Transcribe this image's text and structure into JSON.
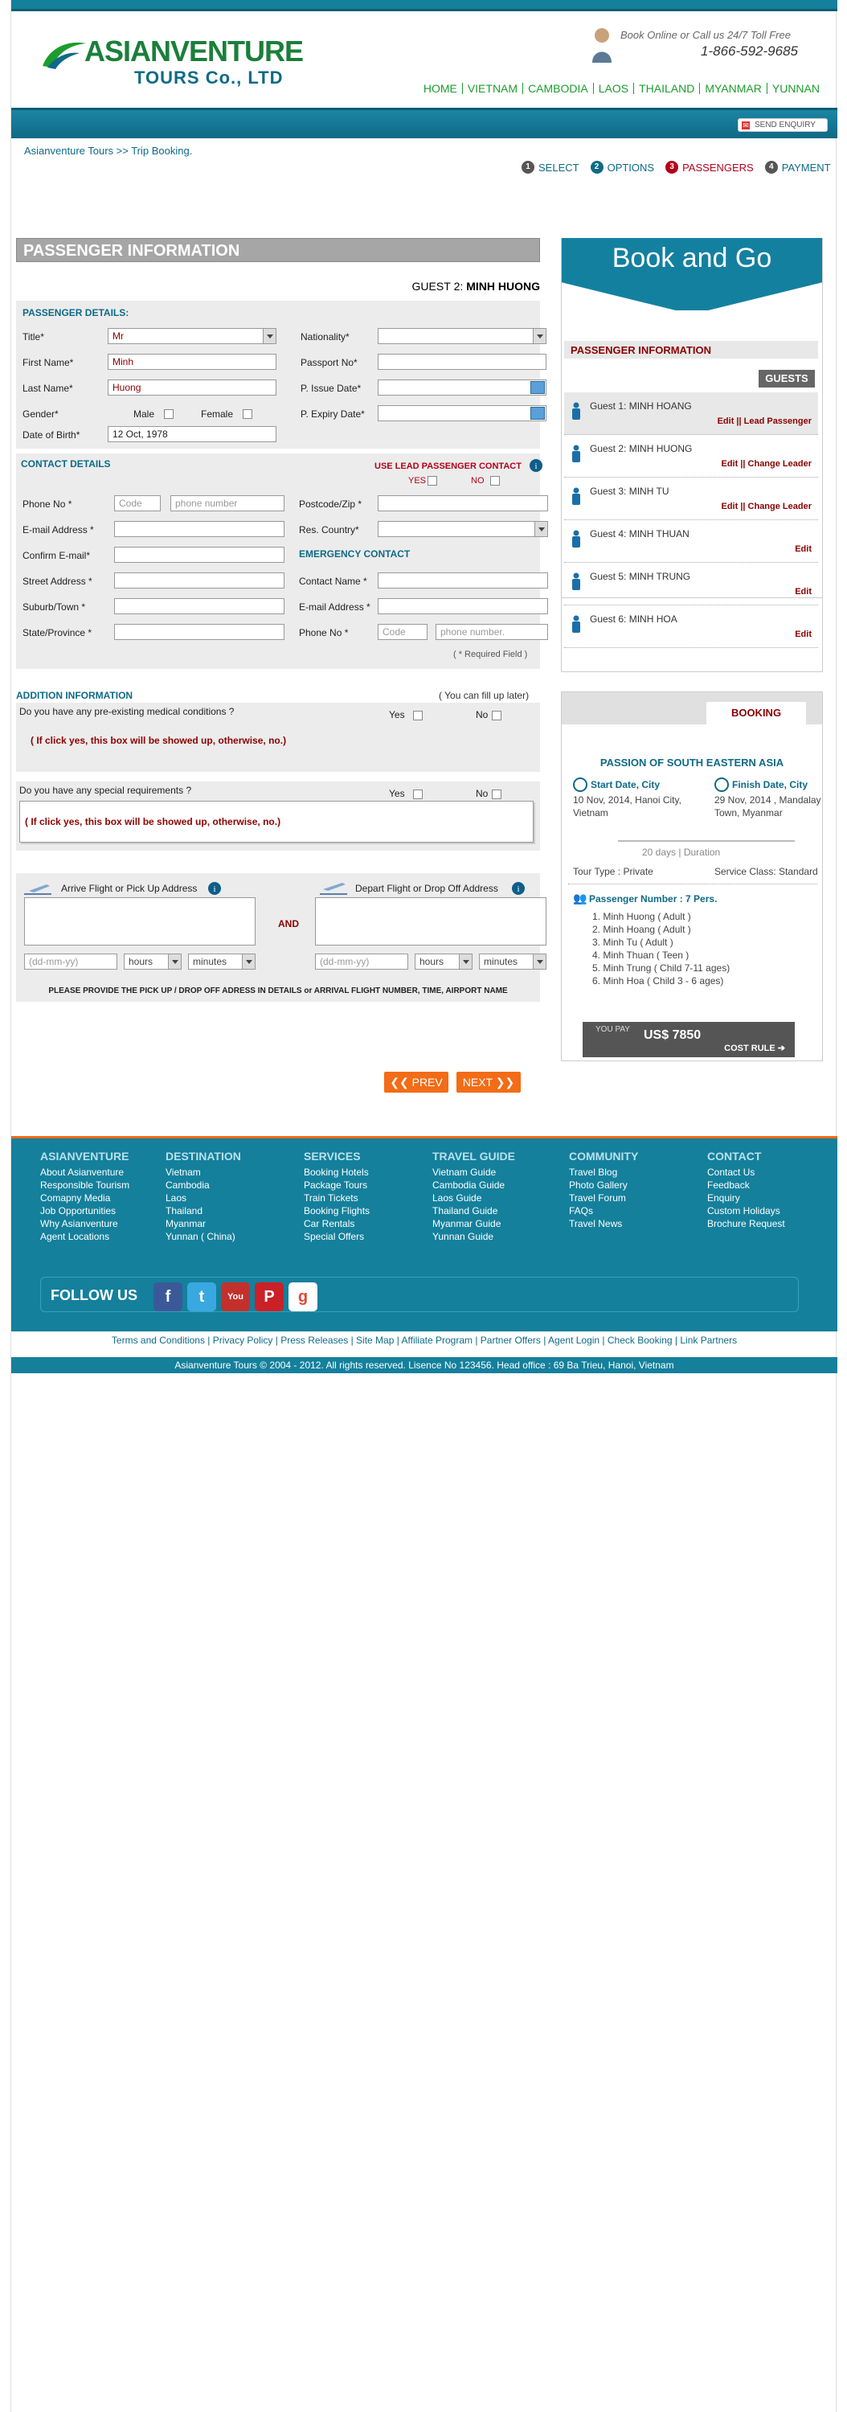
{
  "header": {
    "brand_main": "ASIANVENTURE",
    "brand_sub": "TOURS Co., LTD",
    "call_text": "Book Online or Call us 24/7 Toll Free",
    "phone": "1-866-592-9685",
    "nav": [
      "HOME",
      "VIETNAM",
      "CAMBODIA",
      "LAOS",
      "THAILAND",
      "MYANMAR",
      "YUNNAN"
    ],
    "send_enquiry": "SEND ENQUIRY"
  },
  "breadcrumb": "Asianventure Tours >> Trip Booking.",
  "steps": [
    {
      "num": "1",
      "label": "SELECT"
    },
    {
      "num": "2",
      "label": "OPTIONS"
    },
    {
      "num": "3",
      "label": "PASSENGERS"
    },
    {
      "num": "4",
      "label": "PAYMENT"
    }
  ],
  "form": {
    "title": "PASSENGER INFORMATION",
    "guest_label": "GUEST",
    "guest_num": "2:",
    "guest_name": "MINH HUONG",
    "passenger_details": "PASSENGER DETAILS:",
    "title_label": "Title*",
    "title_value": "Mr",
    "first_name_label": "First Name*",
    "first_name": "Minh",
    "last_name_label": "Last Name*",
    "last_name": "Huong",
    "gender_label": "Gender*",
    "male": "Male",
    "female": "Female",
    "dob_label": "Date of Birth*",
    "dob": "12 Oct, 1978",
    "nationality_label": "Nationality*",
    "passport_label": "Passport No*",
    "issue_label": "P. Issue Date*",
    "expiry_label": "P. Expiry Date*",
    "contact_details": "CONTACT DETAILS",
    "use_lead": "USE LEAD PASSENGER CONTACT",
    "yes": "YES",
    "no": "NO",
    "phone_label": "Phone No *",
    "code_ph": "Code",
    "phone_ph": "phone number",
    "email_label": "E-mail Address *",
    "confirm_email_label": "Confirm E-mail*",
    "street_label": "Street Address *",
    "suburb_label": "Suburb/Town *",
    "state_label": "State/Province  *",
    "postcode_label": "Postcode/Zip  *",
    "res_country_label": "Res. Country*",
    "emergency": "EMERGENCY CONTACT",
    "contact_name_label": "Contact Name *",
    "em_email_label": "E-mail Address *",
    "em_phone_label": "Phone  No *",
    "em_phone_ph": "phone number.",
    "required": "( * Required Field )",
    "addition": "ADDITION INFORMATION",
    "fill_later": "( You can fill up later)",
    "medical_q": "Do you have any pre-existing medical conditions ?",
    "yes_l": "Yes",
    "no_l": "No",
    "medical_note": "( If click yes, this box will be showed up, otherwise, no.)",
    "special_q": "Do you have any special requirements ?",
    "special_note": "( If click yes, this box will be showed up, otherwise, no.)",
    "arrive_label": "Arrive  Flight or Pick Up Address",
    "depart_label": "Depart  Flight or Drop Off  Address",
    "and": "AND",
    "date_ph": "(dd-mm-yy)",
    "hours": "hours",
    "minutes": "minutes",
    "provide_note": "PLEASE PROVIDE THE PICK UP / DROP OFF ADRESS IN DETAILS or ARRIVAL FLIGHT NUMBER, TIME, AIRPORT NAME",
    "prev": "PREV",
    "next": "NEXT"
  },
  "sidebar": {
    "book_go": "Book and Go",
    "pi_title": "PASSENGER INFORMATION",
    "guests_btn": "GUESTS",
    "guests": [
      {
        "label": "Guest 1:",
        "name": "MINH HOANG",
        "link": "Edit || Lead Passenger"
      },
      {
        "label": "Guest 2:",
        "name": "MINH HUONG",
        "link": "Edit || Change Leader"
      },
      {
        "label": "Guest 3:",
        "name": "MINH TU",
        "link": "Edit || Change Leader"
      },
      {
        "label": "Guest 4:",
        "name": "MINH THUAN",
        "link": "Edit"
      },
      {
        "label": "Guest 5:",
        "name": "MINH TRUNG",
        "link": "Edit"
      },
      {
        "label": "Guest 6:",
        "name": "MINH HOA",
        "link": "Edit"
      }
    ]
  },
  "booking": {
    "tab": "BOOKING",
    "tour": "PASSION OF SOUTH EASTERN ASIA",
    "start_h": "Start Date, City",
    "start_v": "10 Nov, 2014, Hanoi City, Vietnam",
    "finish_h": "Finish Date, City",
    "finish_v": "29 Nov, 2014 , Mandalay Town, Myanmar",
    "days": "20 days",
    "duration": "Duration",
    "tour_type": "Tour Type : Private",
    "service_class": "Service Class: Standard",
    "pax": "Passenger Number : 7 Pers.",
    "pax_list": [
      "1. Minh  Huong  ( Adult )",
      "2. Minh Hoang   ( Adult )",
      "3. Minh  Tu        ( Adult )",
      "4. Minh Thuan   ( Teen )",
      "5. Minh Trung    ( Child 7-11 ages)",
      "6. Minh Hoa      ( Child 3 - 6 ages)"
    ],
    "you_pay": "YOU PAY",
    "amount": "US$ 7850",
    "cost_rule": "COST RULE"
  },
  "footer": {
    "cols": [
      {
        "h": "ASIANVENTURE",
        "items": [
          "About Asianventure",
          "Responsible Tourism",
          "Comapny Media",
          "Job Opportunities",
          "Why Asianventure",
          "Agent Locations"
        ]
      },
      {
        "h": "DESTINATION",
        "items": [
          "Vietnam",
          "Cambodia",
          "Laos",
          "Thailand",
          "Myanmar",
          "Yunnan ( China)"
        ]
      },
      {
        "h": "SERVICES",
        "items": [
          "Booking Hotels",
          "Package Tours",
          "Train Tickets",
          "Booking Flights",
          "Car Rentals",
          "Special Offers"
        ]
      },
      {
        "h": "TRAVEL GUIDE",
        "items": [
          "Vietnam Guide",
          "Cambodia Guide",
          "Laos Guide",
          "Thailand Guide",
          "Myanmar Guide",
          "Yunnan Guide"
        ]
      },
      {
        "h": "COMMUNITY",
        "items": [
          "Travel Blog",
          "Photo Gallery",
          "Travel Forum",
          "FAQs",
          "Travel News"
        ]
      },
      {
        "h": "CONTACT",
        "items": [
          "Contact Us",
          "Feedback",
          "Enquiry",
          "Custom Holidays",
          "Brochure Request"
        ]
      }
    ],
    "follow": "FOLLOW US",
    "links": "Terms  and Conditions | Privacy Policy |  Press Releases | Site Map |  Affiliate Program  | Partner Offers  | Agent Login | Check Booking  | Link Partners",
    "copyright": "Asianventure Tours © 2004 - 2012. All rights reserved. Lisence No   123456. Head office : 69 Ba Trieu, Hanoi, Vietnam"
  },
  "colors": {
    "teal": "#14809c",
    "orange": "#f36c17",
    "darkred": "#8b0000",
    "green": "#1d9c2e"
  }
}
